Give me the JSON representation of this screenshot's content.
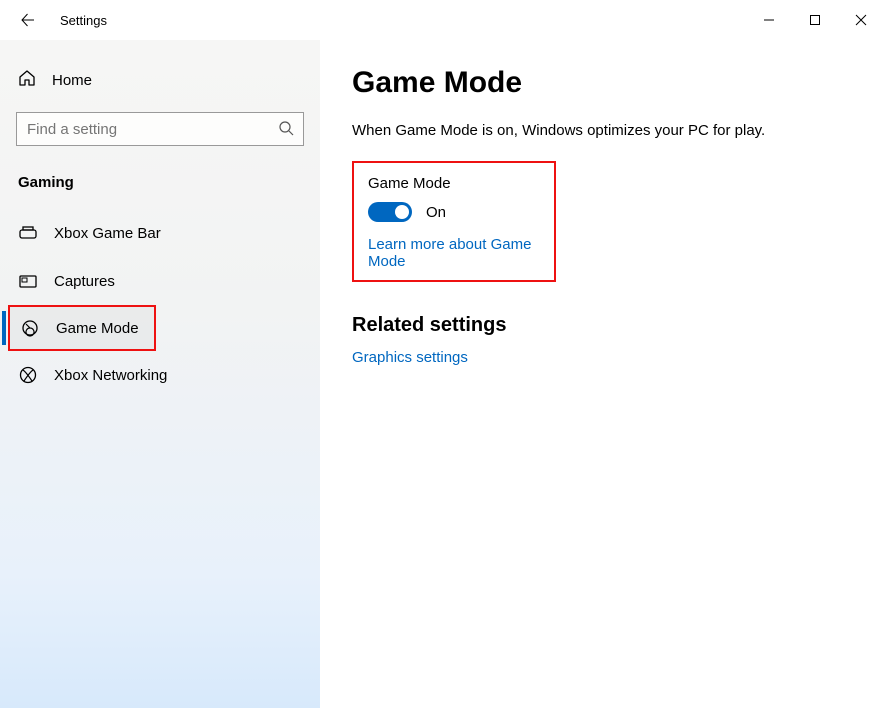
{
  "titlebar": {
    "title": "Settings"
  },
  "sidebar": {
    "home_label": "Home",
    "search_placeholder": "Find a setting",
    "category": "Gaming",
    "items": [
      {
        "label": "Xbox Game Bar"
      },
      {
        "label": "Captures"
      },
      {
        "label": "Game Mode"
      },
      {
        "label": "Xbox Networking"
      }
    ]
  },
  "main": {
    "heading": "Game Mode",
    "description": "When Game Mode is on, Windows optimizes your PC for play.",
    "game_mode": {
      "label": "Game Mode",
      "state": "On",
      "learn_more": "Learn more about Game Mode"
    },
    "related": {
      "heading": "Related settings",
      "links": [
        "Graphics settings"
      ]
    }
  }
}
